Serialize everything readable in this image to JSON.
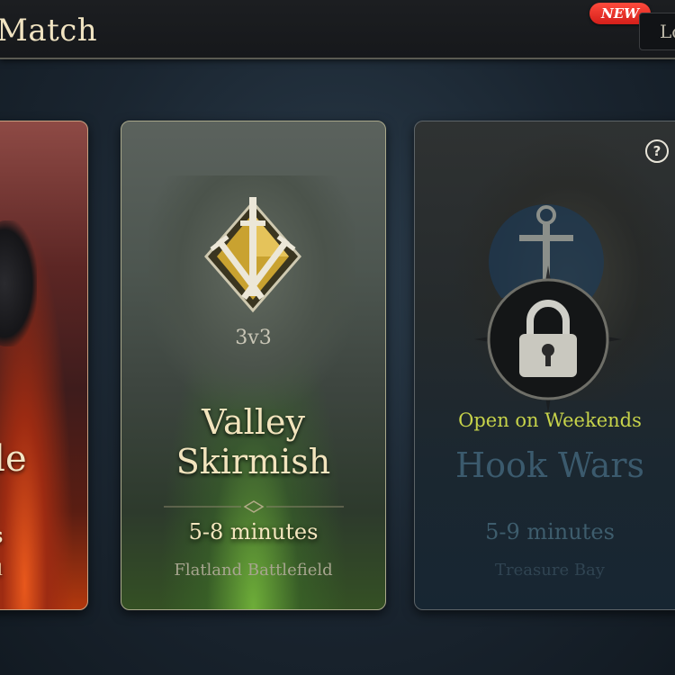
{
  "header": {
    "title": "Match",
    "new_badge": "NEW",
    "corner_button": "Lo"
  },
  "cards": {
    "left": {
      "title": "ttle",
      "duration": "es",
      "location": "eld"
    },
    "valley": {
      "mode": "3v3",
      "title_line1": "Valley",
      "title_line2": "Skirmish",
      "duration": "5-8 minutes",
      "location": "Flatland Battlefield"
    },
    "hook": {
      "status": "Open on Weekends",
      "title": "Hook Wars",
      "duration": "5-9 minutes",
      "location": "Treasure Bay",
      "help_icon": "?"
    }
  },
  "colors": {
    "new_badge": "#e62a22",
    "open_label": "#c7d34a",
    "title_text": "#f2e4bd",
    "locked_text": "#3b5a6d"
  },
  "icons": [
    "crossed-swords-emblem-icon",
    "anchor-icon",
    "padlock-icon",
    "help-icon"
  ]
}
